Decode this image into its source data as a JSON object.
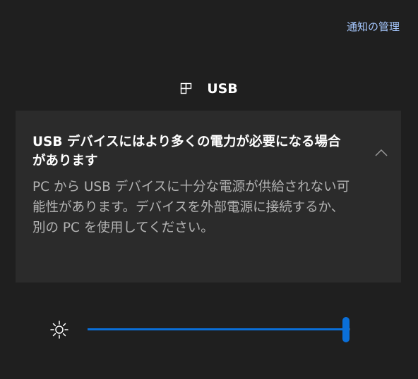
{
  "header": {
    "manage_notifications_label": "通知の管理"
  },
  "group": {
    "icon": "usb-device-icon",
    "title": "USB"
  },
  "notification": {
    "title": "USB デバイスにはより多くの電力が必要になる場合があります",
    "body": "PC から USB デバイスに十分な電源が供給されない可能性があります。デバイスを外部電源に接続するか、別の PC を使用してください。",
    "collapse_icon": "chevron-up-icon"
  },
  "brightness": {
    "icon": "sun-icon",
    "level": 1.0,
    "accent_color": "#0a6fd9"
  },
  "colors": {
    "background": "#1f1f1f",
    "toast_background": "#2b2b2b",
    "link": "#a6c8ff",
    "body_text": "#b3b3b3"
  }
}
